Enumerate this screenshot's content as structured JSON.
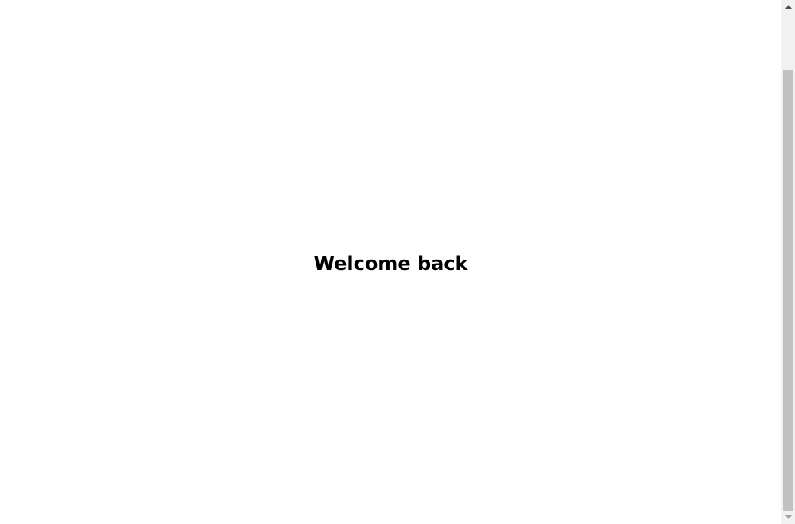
{
  "page": {
    "heading": "Welcome back"
  },
  "scrollbar": {
    "position_fraction": 0.13,
    "up_icon": "triangle-up-icon",
    "down_icon": "triangle-down-icon"
  },
  "colors": {
    "background": "#ffffff",
    "text": "#000000",
    "scroll_track": "#f1f1f1",
    "scroll_thumb": "#c1c1c1"
  }
}
